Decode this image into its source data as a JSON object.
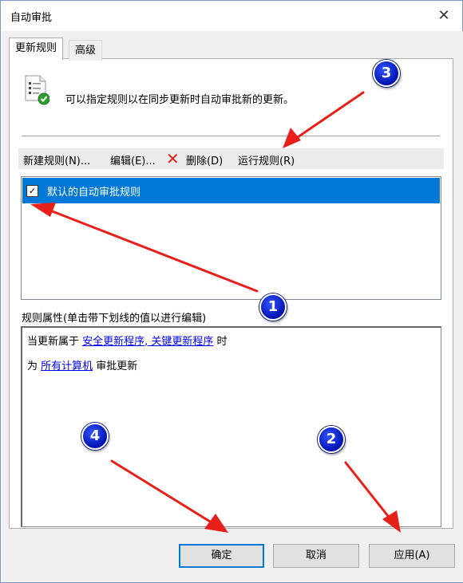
{
  "window": {
    "title": "自动审批",
    "close_glyph": "✕"
  },
  "tabs": [
    {
      "label": "更新规则"
    },
    {
      "label": "高级"
    }
  ],
  "description": "可以指定规则以在同步更新时自动审批新的更新。",
  "toolbar": {
    "new_rule": "新建规则(N)...",
    "edit": "编辑(E)...",
    "delete_glyph": "✕",
    "delete": "删除(D)",
    "run_rule": "运行规则(R)"
  },
  "rules": [
    {
      "label": "默认的自动审批规则",
      "checked": true,
      "check_glyph": "✓"
    }
  ],
  "properties": {
    "label": "规则属性(单击带下划线的值以进行编辑)",
    "line1_prefix": "当更新属于 ",
    "line1_link": "安全更新程序, 关键更新程序",
    "line1_suffix": " 时",
    "line2_prefix": "为 ",
    "line2_link": "所有计算机",
    "line2_suffix": " 审批更新"
  },
  "buttons": {
    "ok": "确定",
    "cancel": "取消",
    "apply": "应用(A)"
  },
  "annotations": {
    "badges": [
      "1",
      "2",
      "3",
      "4"
    ],
    "badge_color": "#0a1fd6",
    "arrow_color": "#e8201a"
  },
  "colors": {
    "selection": "#0078d7",
    "link": "#0000ee",
    "dialog_bg": "#f0f0f0"
  }
}
